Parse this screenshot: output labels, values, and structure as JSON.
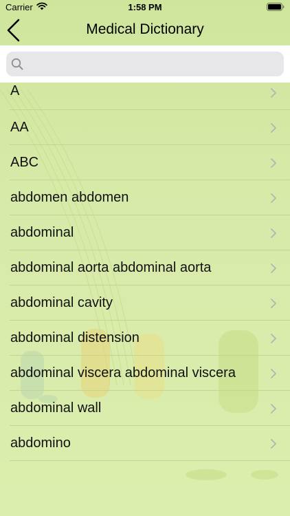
{
  "status_bar": {
    "carrier": "Carrier",
    "time": "1:58 PM"
  },
  "nav": {
    "title": "Medical Dictionary",
    "back_icon": "chevron-left-icon"
  },
  "search": {
    "placeholder": "",
    "value": "",
    "icon": "search-icon"
  },
  "list": {
    "items": [
      {
        "label": "A"
      },
      {
        "label": "AA"
      },
      {
        "label": "ABC"
      },
      {
        "label": "abdomen abdomen"
      },
      {
        "label": "abdominal"
      },
      {
        "label": "abdominal aorta abdominal aorta"
      },
      {
        "label": "abdominal cavity"
      },
      {
        "label": "abdominal distension"
      },
      {
        "label": "abdominal viscera abdominal viscera"
      },
      {
        "label": "abdominal wall"
      },
      {
        "label": "abdomino"
      }
    ]
  },
  "colors": {
    "background": "#d8eaa9",
    "separator": "#c3d491",
    "search_field": "#e7e7ea",
    "chevron": "#b4b4b4"
  }
}
